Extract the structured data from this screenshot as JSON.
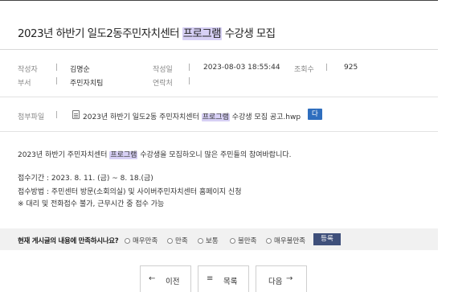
{
  "post": {
    "title_prefix": "2023년 하반기 일도2동주민자치센터",
    "title_highlight": "프로그램",
    "title_suffix": "수강생 모집"
  },
  "meta": {
    "author_label": "작성자",
    "author": "김명순",
    "date_label": "작성일",
    "date": "2023-08-03 18:55:44",
    "views_label": "조회수",
    "views": "925",
    "dept_label": "부서",
    "dept": "주민자치팀",
    "contact_label": "연락처",
    "contact": ""
  },
  "attachment": {
    "label": "첨부파일",
    "file_prefix": "2023년 하반기 일도2동 주민자치센터",
    "file_highlight": "프로그램",
    "file_suffix": "수강생 모집 공고.hwp",
    "download_label": "다운로드"
  },
  "content": {
    "line1_prefix": "2023년 하반기 주민자치센터",
    "line1_highlight": "프로그램",
    "line1_suffix": "수강생을 모집하오니 많은 주민들의 참여바랍니다.",
    "line2": "접수기간 : 2023. 8. 11. (금) ~ 8. 18.(금)",
    "line3": "접수방법 : 주민센터 방문(소회의실) 및 사이버주민자치센터 홈페이지 신청",
    "line4": "※ 대리 및 전화접수 불가, 근무시간 중 접수 가능"
  },
  "survey": {
    "question": "현재 게시글의 내용에 만족하시나요?",
    "options": [
      "매우만족",
      "만족",
      "보통",
      "불만족",
      "매우불만족"
    ],
    "submit_label": "등록"
  },
  "nav": {
    "prev_label": "이전",
    "list_label": "목록",
    "next_label": "다음"
  }
}
